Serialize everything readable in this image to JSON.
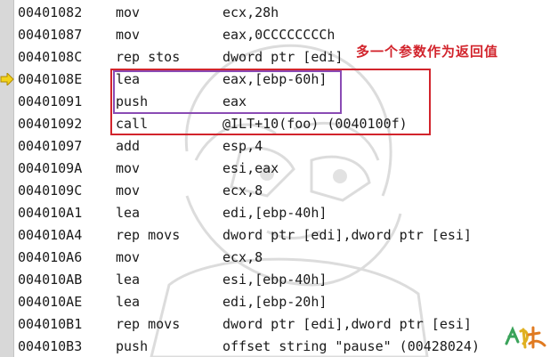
{
  "code_lines": [
    {
      "address": "00401082",
      "mnemonic": "mov",
      "operands": "ecx,28h"
    },
    {
      "address": "00401087",
      "mnemonic": "mov",
      "operands": "eax,0CCCCCCCCh"
    },
    {
      "address": "0040108C",
      "mnemonic": "rep stos",
      "operands": "dword ptr [edi]"
    },
    {
      "address": "0040108E",
      "mnemonic": "lea",
      "operands": "eax,[ebp-60h]"
    },
    {
      "address": "00401091",
      "mnemonic": "push",
      "operands": "eax"
    },
    {
      "address": "00401092",
      "mnemonic": "call",
      "operands": "@ILT+10(foo) (0040100f)"
    },
    {
      "address": "00401097",
      "mnemonic": "add",
      "operands": "esp,4"
    },
    {
      "address": "0040109A",
      "mnemonic": "mov",
      "operands": "esi,eax"
    },
    {
      "address": "0040109C",
      "mnemonic": "mov",
      "operands": "ecx,8"
    },
    {
      "address": "004010A1",
      "mnemonic": "lea",
      "operands": "edi,[ebp-40h]"
    },
    {
      "address": "004010A4",
      "mnemonic": "rep movs",
      "operands": "dword ptr [edi],dword ptr [esi]"
    },
    {
      "address": "004010A6",
      "mnemonic": "mov",
      "operands": "ecx,8"
    },
    {
      "address": "004010AB",
      "mnemonic": "lea",
      "operands": "esi,[ebp-40h]"
    },
    {
      "address": "004010AE",
      "mnemonic": "lea",
      "operands": "edi,[ebp-20h]"
    },
    {
      "address": "004010B1",
      "mnemonic": "rep movs",
      "operands": "dword ptr [edi],dword ptr [esi]"
    },
    {
      "address": "004010B3",
      "mnemonic": "push",
      "operands": "offset string \"pause\" (00428024)"
    }
  ],
  "current_line_index": 3,
  "annotation": {
    "text": "多一个参数作为返回值",
    "color": "#d2242c"
  },
  "icons": {
    "current_instruction": "yellow-arrow-icon",
    "watermark": "anime-character-watermark",
    "signature": "handwritten-signature"
  },
  "colors": {
    "gutter": "#d8d8d8",
    "highlight_red": "#d2242c",
    "highlight_purple": "#8a4bb4",
    "arrow": "#f2d21a",
    "text": "#1a1a1a"
  }
}
